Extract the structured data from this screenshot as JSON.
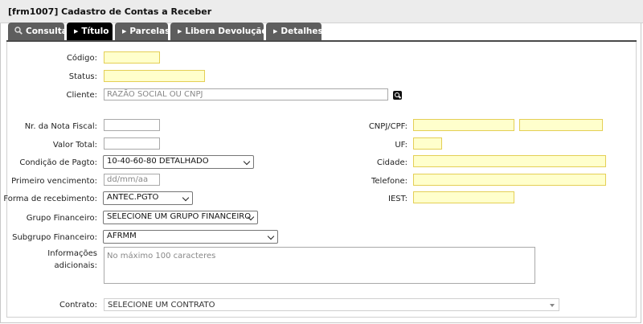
{
  "window": {
    "title": "[frm1007] Cadastro de Contas a Receber"
  },
  "tabs": [
    {
      "label": "Consulta",
      "icon": "magnifier-icon",
      "active": false
    },
    {
      "label": "Título",
      "icon": "arrow-right-icon",
      "active": true
    },
    {
      "label": "Parcelas",
      "icon": "arrow-right-icon",
      "active": false
    },
    {
      "label": "Libera Devolução",
      "icon": "arrow-right-icon",
      "active": false
    },
    {
      "label": "Detalhes",
      "icon": "arrow-right-icon",
      "active": false
    }
  ],
  "form": {
    "codigo": {
      "label": "Código:",
      "value": ""
    },
    "status": {
      "label": "Status:",
      "value": ""
    },
    "cliente": {
      "label": "Cliente:",
      "placeholder": "RAZÃO SOCIAL OU CNPJ"
    },
    "nota_fiscal": {
      "label": "Nr. da Nota Fiscal:",
      "value": ""
    },
    "valor_total": {
      "label": "Valor Total:",
      "value": ""
    },
    "condicao_pagto": {
      "label": "Condição de Pagto:",
      "value": "10-40-60-80 DETALHADO"
    },
    "primeiro_vencimento": {
      "label": "Primeiro vencimento:",
      "placeholder": "dd/mm/aa"
    },
    "forma_recebimento": {
      "label": "Forma de recebimento:",
      "value": "ANTEC.PGTO"
    },
    "grupo_financeiro": {
      "label": "Grupo Financeiro:",
      "value": "SELECIONE UM GRUPO FINANCEIRO"
    },
    "subgrupo_financeiro": {
      "label": "Subgrupo Financeiro:",
      "value": "AFRMM"
    },
    "informacoes": {
      "label": "Informações adicionais:",
      "placeholder": "No máximo 100 caracteres"
    },
    "contrato": {
      "label": "Contrato:",
      "value": "SELECIONE UM CONTRATO"
    },
    "cnpj_cpf": {
      "label": "CNPJ/CPF:",
      "value1": "",
      "value2": ""
    },
    "uf": {
      "label": "UF:",
      "value": ""
    },
    "cidade": {
      "label": "Cidade:",
      "value": ""
    },
    "telefone": {
      "label": "Telefone:",
      "value": ""
    },
    "iest": {
      "label": "IEST:",
      "value": ""
    }
  },
  "colors": {
    "required_bg": "#ffffcc",
    "required_border": "#e4cf55",
    "tab_bg": "#5e5e5e",
    "tab_active_bg": "#000000"
  }
}
